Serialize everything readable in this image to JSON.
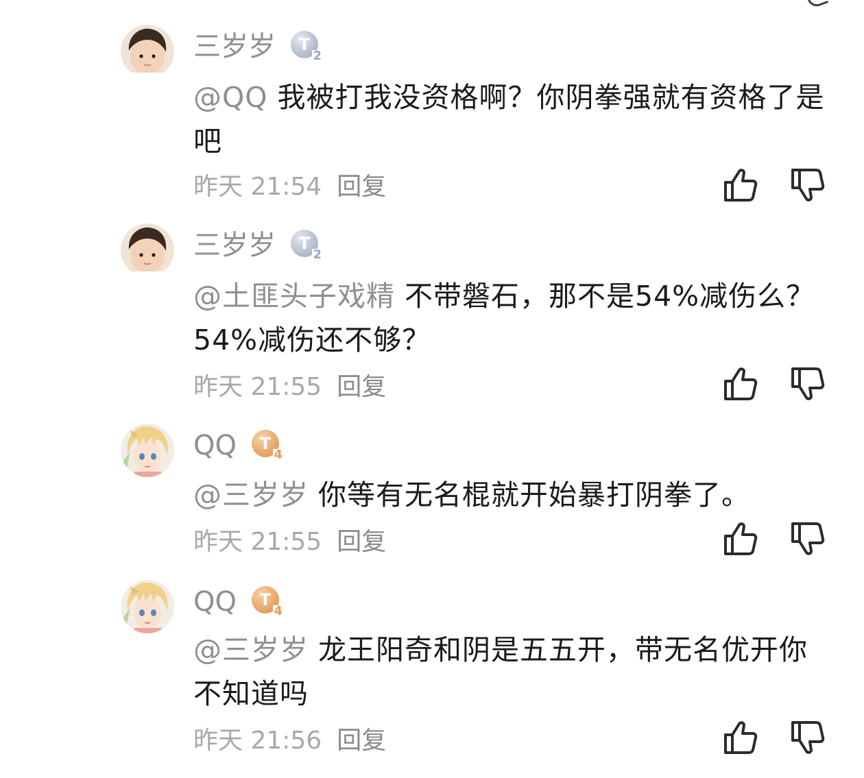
{
  "comments": [
    {
      "username": "三岁岁",
      "level": "2",
      "level_style": "silver",
      "avatar": "toddler-photo-avatar",
      "mention": "@QQ",
      "text": "我被打我没资格啊？你阴拳强就有资格了是吧",
      "time": "昨天 21:54",
      "reply_label": "回复"
    },
    {
      "username": "三岁岁",
      "level": "2",
      "level_style": "silver",
      "avatar": "toddler-photo-avatar",
      "mention": "@土匪头子戏精",
      "text": "不带磐石，那不是54%减伤么？54%减伤还不够？",
      "time": "昨天 21:55",
      "reply_label": "回复"
    },
    {
      "username": "QQ",
      "level": "4",
      "level_style": "gold",
      "avatar": "anime-boy-avatar",
      "mention": "@三岁岁",
      "text": "你等有无名棍就开始暴打阴拳了。",
      "time": "昨天 21:55",
      "reply_label": "回复"
    },
    {
      "username": "QQ",
      "level": "4",
      "level_style": "gold",
      "avatar": "anime-boy-avatar",
      "mention": "@三岁岁",
      "text": "龙王阳奇和阴是五五开，带无名优开你不知道吗",
      "time": "昨天 21:56",
      "reply_label": "回复"
    }
  ],
  "icons": {
    "like": "thumbs-up-icon",
    "dislike": "thumbs-down-icon"
  },
  "colors": {
    "text": "#1a1a1a",
    "muted": "#8f8f8f",
    "badge_silver": "#9aa6b8",
    "badge_gold": "#e39a5a"
  }
}
